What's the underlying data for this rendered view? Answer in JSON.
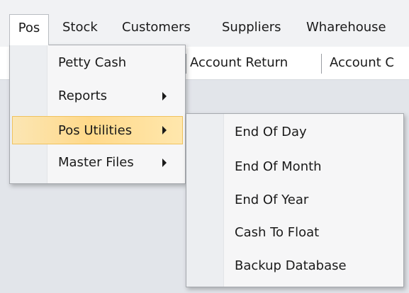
{
  "menubar": {
    "items": [
      "Pos",
      "Stock",
      "Customers",
      "Suppliers",
      "Wharehouse"
    ]
  },
  "toolbar": {
    "items": [
      "Account Return",
      "Account C"
    ]
  },
  "pos_menu": {
    "items": [
      {
        "label": "Petty Cash",
        "has_submenu": false
      },
      {
        "label": "Reports",
        "has_submenu": true
      },
      {
        "label": "Pos Utilities",
        "has_submenu": true,
        "highlighted": true
      },
      {
        "label": "Master Files",
        "has_submenu": true
      }
    ]
  },
  "pos_utilities_submenu": {
    "items": [
      "End Of Day",
      "End Of Month",
      "End Of Year",
      "Cash To Float",
      "Backup Database"
    ]
  },
  "colors": {
    "highlight": "#ffd98a",
    "highlight_border": "#f0c25e",
    "menu_background": "#f6f6f7",
    "workspace_background": "#e2e5ea"
  },
  "icons": {
    "submenu_arrow": "chevron-right-icon"
  }
}
